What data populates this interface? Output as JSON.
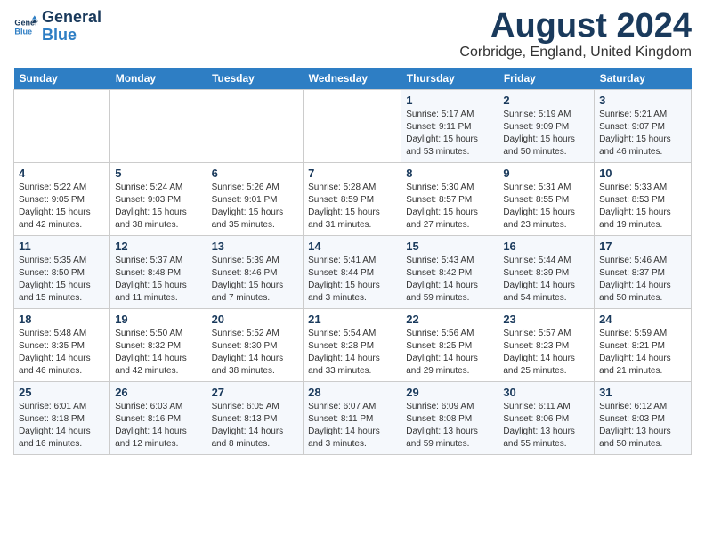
{
  "header": {
    "logo_line1": "General",
    "logo_line2": "Blue",
    "month": "August 2024",
    "location": "Corbridge, England, United Kingdom"
  },
  "weekdays": [
    "Sunday",
    "Monday",
    "Tuesday",
    "Wednesday",
    "Thursday",
    "Friday",
    "Saturday"
  ],
  "weeks": [
    [
      {
        "day": "",
        "info": ""
      },
      {
        "day": "",
        "info": ""
      },
      {
        "day": "",
        "info": ""
      },
      {
        "day": "",
        "info": ""
      },
      {
        "day": "1",
        "info": "Sunrise: 5:17 AM\nSunset: 9:11 PM\nDaylight: 15 hours\nand 53 minutes."
      },
      {
        "day": "2",
        "info": "Sunrise: 5:19 AM\nSunset: 9:09 PM\nDaylight: 15 hours\nand 50 minutes."
      },
      {
        "day": "3",
        "info": "Sunrise: 5:21 AM\nSunset: 9:07 PM\nDaylight: 15 hours\nand 46 minutes."
      }
    ],
    [
      {
        "day": "4",
        "info": "Sunrise: 5:22 AM\nSunset: 9:05 PM\nDaylight: 15 hours\nand 42 minutes."
      },
      {
        "day": "5",
        "info": "Sunrise: 5:24 AM\nSunset: 9:03 PM\nDaylight: 15 hours\nand 38 minutes."
      },
      {
        "day": "6",
        "info": "Sunrise: 5:26 AM\nSunset: 9:01 PM\nDaylight: 15 hours\nand 35 minutes."
      },
      {
        "day": "7",
        "info": "Sunrise: 5:28 AM\nSunset: 8:59 PM\nDaylight: 15 hours\nand 31 minutes."
      },
      {
        "day": "8",
        "info": "Sunrise: 5:30 AM\nSunset: 8:57 PM\nDaylight: 15 hours\nand 27 minutes."
      },
      {
        "day": "9",
        "info": "Sunrise: 5:31 AM\nSunset: 8:55 PM\nDaylight: 15 hours\nand 23 minutes."
      },
      {
        "day": "10",
        "info": "Sunrise: 5:33 AM\nSunset: 8:53 PM\nDaylight: 15 hours\nand 19 minutes."
      }
    ],
    [
      {
        "day": "11",
        "info": "Sunrise: 5:35 AM\nSunset: 8:50 PM\nDaylight: 15 hours\nand 15 minutes."
      },
      {
        "day": "12",
        "info": "Sunrise: 5:37 AM\nSunset: 8:48 PM\nDaylight: 15 hours\nand 11 minutes."
      },
      {
        "day": "13",
        "info": "Sunrise: 5:39 AM\nSunset: 8:46 PM\nDaylight: 15 hours\nand 7 minutes."
      },
      {
        "day": "14",
        "info": "Sunrise: 5:41 AM\nSunset: 8:44 PM\nDaylight: 15 hours\nand 3 minutes."
      },
      {
        "day": "15",
        "info": "Sunrise: 5:43 AM\nSunset: 8:42 PM\nDaylight: 14 hours\nand 59 minutes."
      },
      {
        "day": "16",
        "info": "Sunrise: 5:44 AM\nSunset: 8:39 PM\nDaylight: 14 hours\nand 54 minutes."
      },
      {
        "day": "17",
        "info": "Sunrise: 5:46 AM\nSunset: 8:37 PM\nDaylight: 14 hours\nand 50 minutes."
      }
    ],
    [
      {
        "day": "18",
        "info": "Sunrise: 5:48 AM\nSunset: 8:35 PM\nDaylight: 14 hours\nand 46 minutes."
      },
      {
        "day": "19",
        "info": "Sunrise: 5:50 AM\nSunset: 8:32 PM\nDaylight: 14 hours\nand 42 minutes."
      },
      {
        "day": "20",
        "info": "Sunrise: 5:52 AM\nSunset: 8:30 PM\nDaylight: 14 hours\nand 38 minutes."
      },
      {
        "day": "21",
        "info": "Sunrise: 5:54 AM\nSunset: 8:28 PM\nDaylight: 14 hours\nand 33 minutes."
      },
      {
        "day": "22",
        "info": "Sunrise: 5:56 AM\nSunset: 8:25 PM\nDaylight: 14 hours\nand 29 minutes."
      },
      {
        "day": "23",
        "info": "Sunrise: 5:57 AM\nSunset: 8:23 PM\nDaylight: 14 hours\nand 25 minutes."
      },
      {
        "day": "24",
        "info": "Sunrise: 5:59 AM\nSunset: 8:21 PM\nDaylight: 14 hours\nand 21 minutes."
      }
    ],
    [
      {
        "day": "25",
        "info": "Sunrise: 6:01 AM\nSunset: 8:18 PM\nDaylight: 14 hours\nand 16 minutes."
      },
      {
        "day": "26",
        "info": "Sunrise: 6:03 AM\nSunset: 8:16 PM\nDaylight: 14 hours\nand 12 minutes."
      },
      {
        "day": "27",
        "info": "Sunrise: 6:05 AM\nSunset: 8:13 PM\nDaylight: 14 hours\nand 8 minutes."
      },
      {
        "day": "28",
        "info": "Sunrise: 6:07 AM\nSunset: 8:11 PM\nDaylight: 14 hours\nand 3 minutes."
      },
      {
        "day": "29",
        "info": "Sunrise: 6:09 AM\nSunset: 8:08 PM\nDaylight: 13 hours\nand 59 minutes."
      },
      {
        "day": "30",
        "info": "Sunrise: 6:11 AM\nSunset: 8:06 PM\nDaylight: 13 hours\nand 55 minutes."
      },
      {
        "day": "31",
        "info": "Sunrise: 6:12 AM\nSunset: 8:03 PM\nDaylight: 13 hours\nand 50 minutes."
      }
    ]
  ]
}
